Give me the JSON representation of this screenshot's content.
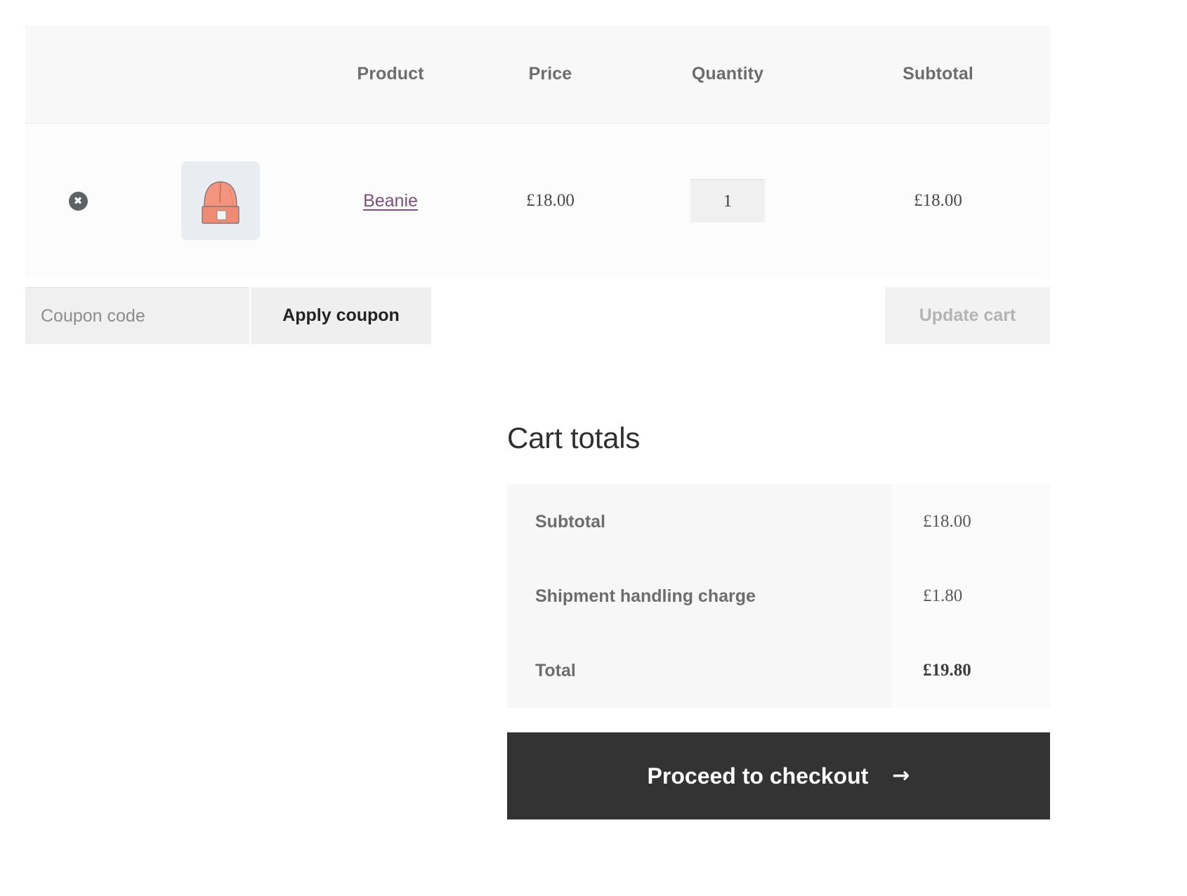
{
  "cart_table": {
    "headers": {
      "remove": "",
      "thumbnail": "",
      "product": "Product",
      "price": "Price",
      "quantity": "Quantity",
      "subtotal": "Subtotal"
    },
    "items": [
      {
        "remove_glyph": "✖",
        "thumbnail_alt": "beanie-product-thumbnail",
        "name": "Beanie",
        "price": "£18.00",
        "quantity": "1",
        "subtotal": "£18.00"
      }
    ]
  },
  "actions": {
    "coupon_placeholder": "Coupon code",
    "coupon_value": "",
    "apply_coupon_label": "Apply coupon",
    "update_cart_label": "Update cart"
  },
  "cart_totals": {
    "title": "Cart totals",
    "rows": [
      {
        "label": "Subtotal",
        "value": "£18.00"
      },
      {
        "label": "Shipment handling charge",
        "value": "£1.80"
      },
      {
        "label": "Total",
        "value": "£19.80"
      }
    ],
    "checkout_label": "Proceed to checkout",
    "checkout_arrow": "→"
  },
  "colors": {
    "link": "#7f4e80",
    "checkout_bg": "#333333",
    "header_bg": "#f8f8f8",
    "totals_label_bg": "#f7f7f7",
    "beanie": "#f08a72"
  }
}
